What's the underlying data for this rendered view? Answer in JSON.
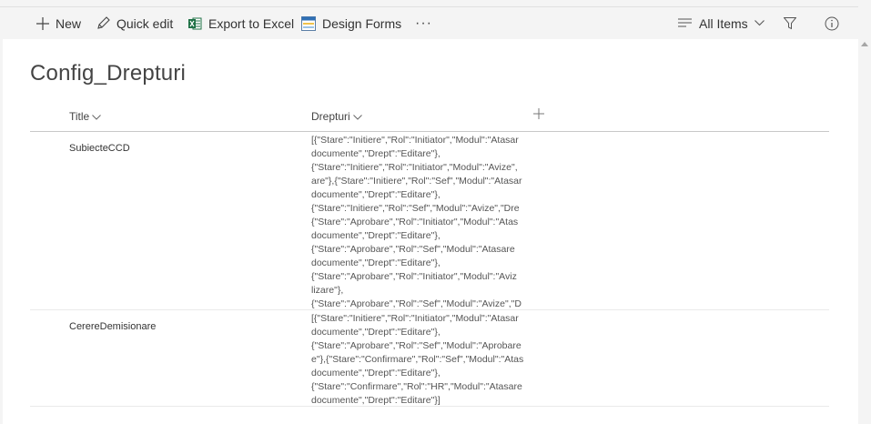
{
  "toolbar": {
    "new_label": "New",
    "quick_edit_label": "Quick edit",
    "export_label": "Export to Excel",
    "design_label": "Design Forms",
    "more_label": "···",
    "view_label": "All Items"
  },
  "list": {
    "title": "Config_Drepturi",
    "columns": {
      "title": "Title",
      "drepturi": "Drepturi"
    },
    "rows": [
      {
        "title": "SubiecteCCD",
        "drepturi_lines": [
          "[{\"Stare\":\"Initiere\",\"Rol\":\"Initiator\",\"Modul\":\"Atasar",
          "documente\",\"Drept\":\"Editare\"},",
          "{\"Stare\":\"Initiere\",\"Rol\":\"Initiator\",\"Modul\":\"Avize\",",
          "are\"},{\"Stare\":\"Initiere\",\"Rol\":\"Sef\",\"Modul\":\"Atasar",
          "documente\",\"Drept\":\"Editare\"},",
          "{\"Stare\":\"Initiere\",\"Rol\":\"Sef\",\"Modul\":\"Avize\",\"Dre",
          "{\"Stare\":\"Aprobare\",\"Rol\":\"Initiator\",\"Modul\":\"Atas",
          "documente\",\"Drept\":\"Editare\"},",
          "{\"Stare\":\"Aprobare\",\"Rol\":\"Sef\",\"Modul\":\"Atasare",
          "documente\",\"Drept\":\"Editare\"},",
          "{\"Stare\":\"Aprobare\",\"Rol\":\"Initiator\",\"Modul\":\"Aviz",
          "lizare\"},",
          "{\"Stare\":\"Aprobare\",\"Rol\":\"Sef\",\"Modul\":\"Avize\",\"D"
        ]
      },
      {
        "title": "CerereDemisionare",
        "drepturi_lines": [
          "[{\"Stare\":\"Initiere\",\"Rol\":\"Initiator\",\"Modul\":\"Atasar",
          "documente\",\"Drept\":\"Editare\"},",
          "{\"Stare\":\"Aprobare\",\"Rol\":\"Sef\",\"Modul\":\"Aprobare",
          "e\"},{\"Stare\":\"Confirmare\",\"Rol\":\"Sef\",\"Modul\":\"Atas",
          "documente\",\"Drept\":\"Editare\"},",
          "{\"Stare\":\"Confirmare\",\"Rol\":\"HR\",\"Modul\":\"Atasare",
          "documente\",\"Drept\":\"Editare\"}]"
        ]
      }
    ]
  }
}
